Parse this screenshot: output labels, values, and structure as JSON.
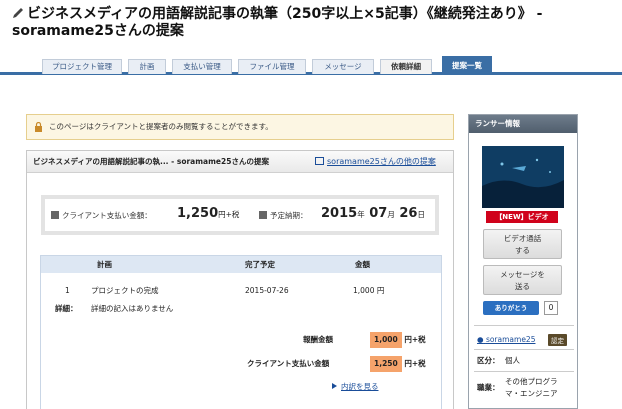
{
  "page": {
    "title": "ビジネスメディアの用語解説記事の執筆（250字以上×5記事）《継続発注あり》 - soramame25さんの提案"
  },
  "tabs": [
    {
      "label": "プロジェクト管理"
    },
    {
      "label": "計画"
    },
    {
      "label": "支払い管理"
    },
    {
      "label": "ファイル管理"
    },
    {
      "label": "メッセージ"
    },
    {
      "label": "依頼詳細"
    },
    {
      "label": "提案一覧"
    }
  ],
  "notice": {
    "text": "このページはクライアントと提案者のみ閲覧することができます。"
  },
  "panel": {
    "heading": "ビジネスメディアの用語解説記事の執... - soramame25さんの提案",
    "other_link": "soramame25さんの他の提案"
  },
  "summary": {
    "payment_label": "クライアント支払い金額：",
    "payment_value": "1,250",
    "payment_unit": "円+税",
    "delivery_label": "予定納期：",
    "delivery_year": "2015",
    "delivery_month": "07",
    "delivery_day": "26",
    "year_unit": "年",
    "month_unit": "月",
    "day_unit": "日"
  },
  "plan_table": {
    "headers": [
      "計画",
      "完了予定",
      "金額"
    ],
    "rows": [
      {
        "no": "1",
        "name": "プロジェクトの完成",
        "date": "2015-07-26",
        "amount": "1,000 円"
      }
    ],
    "detail_label": "詳細：",
    "detail_value": "詳細の記入はありません",
    "reward_label": "報酬金額",
    "reward_value": "1,000",
    "reward_unit": "円+税",
    "client_label": "クライアント支払い金額",
    "client_value": "1,250",
    "client_unit": "円+税",
    "breakdown_link": "内訳を見る"
  },
  "sidebar": {
    "heading": "ランサー情報",
    "new_badge": "【NEW】ビデオ",
    "video_call_line1": "ビデオ通話",
    "video_call_line2": "する",
    "message_line1": "メッセージを",
    "message_line2": "送る",
    "thanks_label": "ありがとう",
    "thanks_count": "0",
    "username": "soramame25",
    "cert_badge": "認定",
    "type_label": "区分：",
    "type_value": "個人",
    "job_label": "職業：",
    "job_value_line1": "その他プログラ",
    "job_value_line2": "マ・エンジニア"
  },
  "colors": {
    "accent": "#3a6ea5",
    "highlight": "#f5a36b",
    "alert": "#d0021b"
  }
}
